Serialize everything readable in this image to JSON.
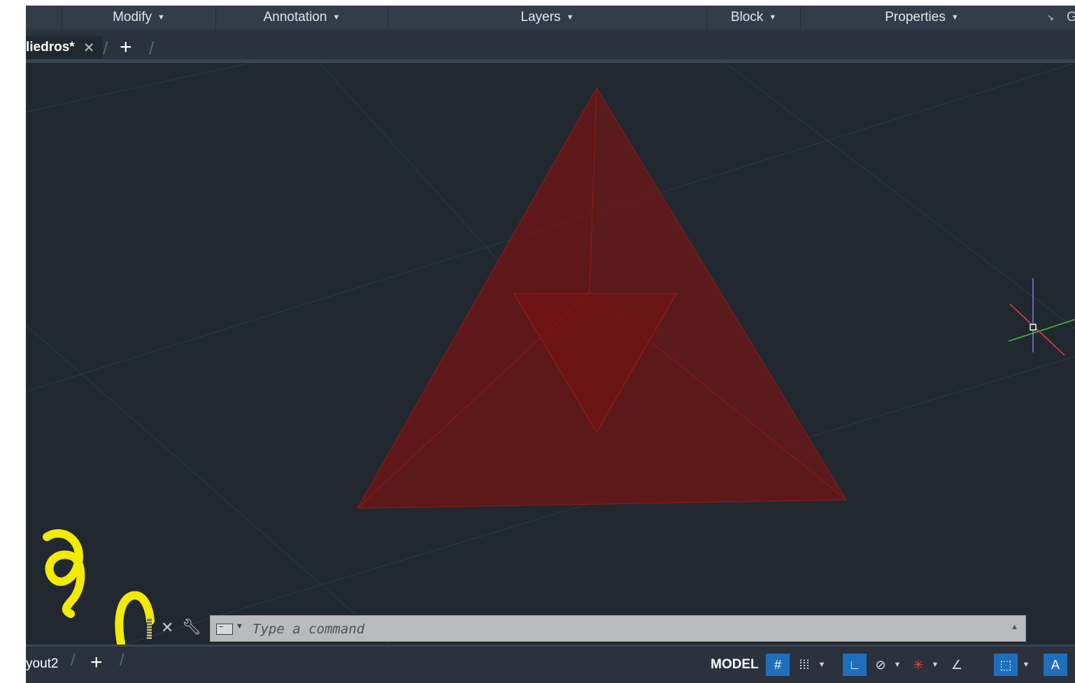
{
  "ribbon": {
    "panels": [
      {
        "label": "Modify"
      },
      {
        "label": "Annotation"
      },
      {
        "label": "Layers"
      },
      {
        "label": "Block"
      },
      {
        "label": "Properties"
      }
    ],
    "launcher_icon": "panel-launcher-arrow-icon",
    "truncated_label": "G"
  },
  "file_tabs": {
    "active_document": "liedros*",
    "close_icon": "close-icon",
    "add_icon": "plus-icon"
  },
  "viewport": {
    "background_color": "#212830",
    "object_color": "#7a1212",
    "ucs_icon": "ucs-crosshair-icon"
  },
  "command_line": {
    "placeholder": "Type a command",
    "close_icon": "close-icon",
    "customize_icon": "wrench-icon",
    "prompt_icon": "command-prompt-icon",
    "recent_icon": "chevron-up-icon"
  },
  "status_bar": {
    "layout_tab": "yout2",
    "add_layout_icon": "plus-icon",
    "model_label": "MODEL",
    "toggles": [
      {
        "icon": "grid-icon",
        "on": true
      },
      {
        "icon": "snap-mode-icon",
        "on": false
      },
      {
        "icon": "ortho-icon",
        "on": true
      },
      {
        "icon": "polar-tracking-icon",
        "on": false
      },
      {
        "icon": "object-snap-tracking-icon",
        "on": false
      },
      {
        "icon": "dynamic-ucs-angle-icon",
        "on": false
      },
      {
        "icon": "object-snap-icon",
        "on": true
      },
      {
        "icon": "annotation-scale-icon",
        "on": true
      }
    ]
  },
  "annotations": {
    "handwriting_color": "#f2ea00"
  }
}
